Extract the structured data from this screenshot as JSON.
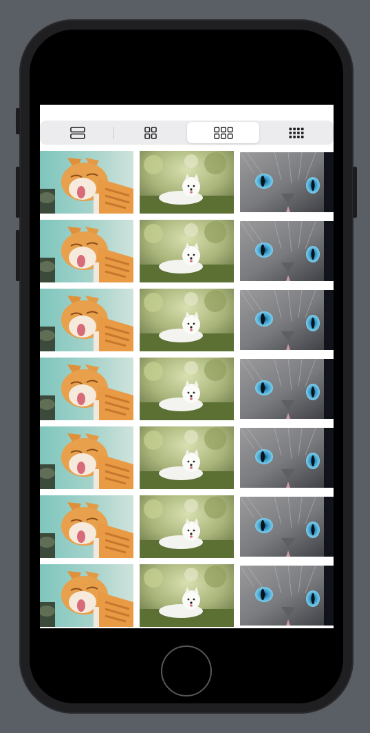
{
  "toolbar": {
    "segments": [
      {
        "icon": "list-rows-icon",
        "selected": false
      },
      {
        "icon": "grid-2-icon",
        "selected": false
      },
      {
        "icon": "grid-3-icon",
        "selected": true
      },
      {
        "icon": "grid-4-icon",
        "selected": false
      }
    ]
  },
  "gallery": {
    "columns": 3,
    "rows": 7,
    "images": [
      "orange-cat-photo",
      "white-dog-photo",
      "blue-eyed-cat-photo"
    ]
  },
  "colors": {
    "segment_bg": "#ececee",
    "segment_selected": "#ffffff",
    "icon": "#1c1c1e",
    "background": "#5a5f66"
  }
}
